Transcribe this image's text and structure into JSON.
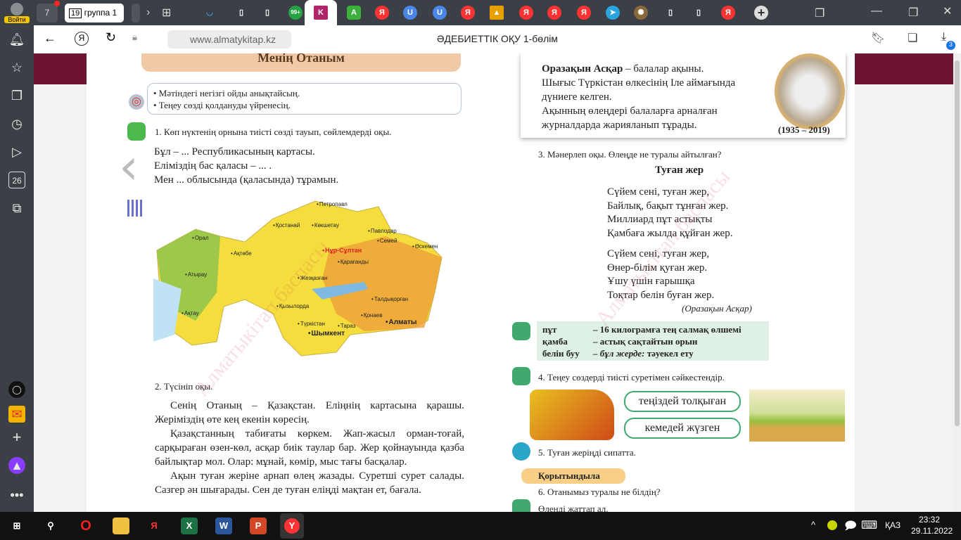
{
  "sidebar": {
    "login_label": "Войти",
    "calendar_day": "26",
    "icons": [
      "bell-icon",
      "star-icon",
      "collections-icon",
      "history-icon",
      "play-icon",
      "calendar-icon",
      "screenshot-icon",
      "alice-icon",
      "mail-icon",
      "add-icon",
      "voice-assistant-icon",
      "more-icon"
    ]
  },
  "tabs": {
    "group_count": "7",
    "group_tab_count": "19",
    "group_tab_label": "группа 1",
    "badge": "99+"
  },
  "address": {
    "url": "www.almatykitap.kz",
    "page_title": "ӘДЕБИЕТТІК ОҚУ 1-бөлім",
    "download_badge": "3"
  },
  "book_left": {
    "header": "Менің Отаным",
    "goals": [
      "• Мәтіндегі негізгі ойды анықтайсың.",
      "• Теңеу сөзді қолдануды үйренесің."
    ],
    "task1": "1. Көп нүктенің орнына тиісті сөзді тауып, сөйлемдерді оқы.",
    "task1_lines": [
      "Бұл – ... Республикасының картасы.",
      "Еліміздің бас қаласы – ... .",
      "Мен ... облысында (қаласында) тұрамын."
    ],
    "cities": [
      "Петропавл",
      "Қостанай",
      "Көкшетау",
      "Павлодар",
      "Орал",
      "Ақтөбе",
      "Нұр-Сұлтан",
      "Семей",
      "Өскемен",
      "Қарағанды",
      "Атырау",
      "Жезқазған",
      "Талдықорған",
      "Қызылорда",
      "Ақтау",
      "Түркістан",
      "Тараз",
      "Қонаев",
      "Алматы",
      "Шымкент"
    ],
    "task2": "2. Түсініп оқы.",
    "paragraphs": [
      "Сенің Отаның – Қазақстан. Еліңнің картасына қарашы. Жеріміздің өте кең екенін көресің.",
      "Қазақстанның табиғаты көркем. Жап-жасыл орман-тоғай, сарқыраған өзен-көл, асқар биік таулар бар. Жер қойнауында қазба байлықтар мол. Олар: мұнай, көмір, мыс тағы басқалар.",
      "Ақын туған жеріне арнап өлең жазады. Суретші сурет салады. Сазгер ән шығарады. Сен де туған еліңді мақтан ет, бағала."
    ],
    "watermark": "Алматыкітап баспасы"
  },
  "book_right": {
    "bio": {
      "name": "Оразақын Асқар",
      "lines": [
        " – балалар ақыны.",
        "Шығыс Түркістан өлкесінің Іле аймағында дүниеге келген.",
        "Ақынның өлеңдері балаларға арналған журналдарда жарияланып тұрады."
      ],
      "years": "(1935 – 2019)"
    },
    "task3": "3. Мәнерлеп оқы. Өлеңде не туралы айтылған?",
    "poem_title": "Туған жер",
    "stanza1": [
      "Сүйем сені, туған жер,",
      "Байлық, бақыт тұнған жер.",
      "Миллиард пұт астықты",
      "Қамбаға жылда құйған жер."
    ],
    "stanza2": [
      "Сүйем сені, туған жер,",
      "Өнер-білім қуған жер.",
      "Ұшу үшін ғарышқа",
      "Тоқтар белін буған жер."
    ],
    "author": "(Оразақын Асқар)",
    "glossary": [
      {
        "term": "пұт",
        "def": "– 16 килограмға тең салмақ өлшемі"
      },
      {
        "term": "қамба",
        "def": "– астық сақтайтын орын"
      },
      {
        "term": "белін буу",
        "def_italic": "– бұл жерде:",
        "def": " тәуекел ету"
      }
    ],
    "task4": "4. Теңеу сөздерді тиісті суретімен сәйкестендір.",
    "pills": [
      "теңіздей толқыған",
      "кемедей жүзген"
    ],
    "task5": "5. Туған жеріңді сипатта.",
    "summary_label": "Қорытындыла",
    "task6": "6. Отанымыз туралы не білдің?",
    "task7": "Өлеңді жаттап ал."
  },
  "taskbar": {
    "lang": "ҚАЗ",
    "time": "23:32",
    "date": "29.11.2022"
  },
  "colors": {
    "maroon": "#6c1430",
    "accent_green": "#3fa96e",
    "gloss_bg": "#dff0e6"
  }
}
